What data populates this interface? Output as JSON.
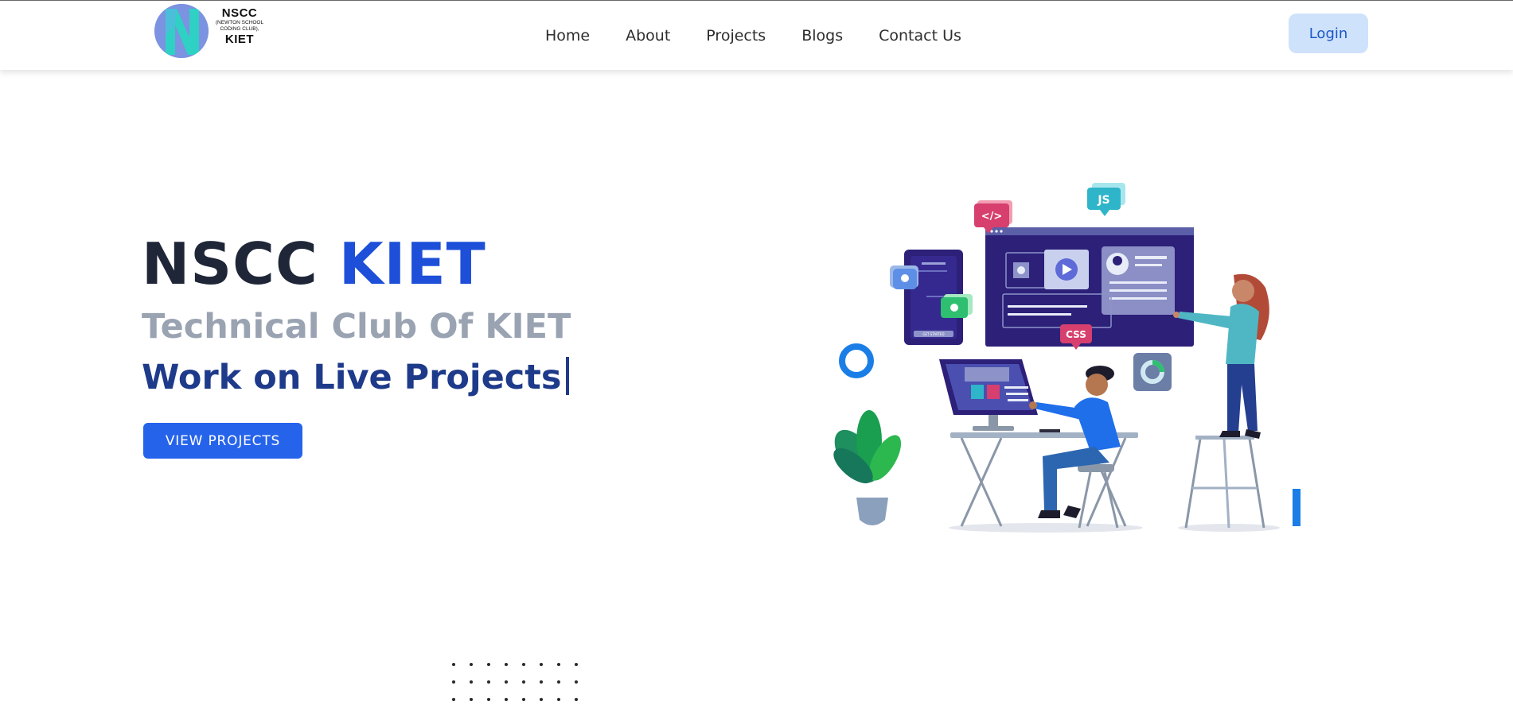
{
  "brand": {
    "logo_title": "NSCC",
    "logo_subtitle_line1": "(NEWTON SCHOOL",
    "logo_subtitle_line2": "CODING CLUB),",
    "logo_kiet": "KIET",
    "colors": {
      "logo_circle": "#7b93e0",
      "logo_n": "#2fd1c4"
    }
  },
  "nav": {
    "links": [
      "Home",
      "About",
      "Projects",
      "Blogs",
      "Contact Us"
    ],
    "login_label": "Login"
  },
  "hero": {
    "title_part1": "NSCC",
    "title_accent": "KIET",
    "subtitle": "Technical Club Of KIET",
    "typed_text": "Work on Live Projects",
    "cta_label": "VIEW PROJECTS"
  },
  "illustration": {
    "badges": {
      "code": "</>",
      "js": "JS",
      "css": "CSS"
    },
    "phone_button": "GET STARTED"
  },
  "colors": {
    "accent": "#1d4fd8",
    "button": "#2563eb",
    "login_bg": "#cfe2fb",
    "heading": "#1f2638",
    "subtitle": "#9aa3b2",
    "typed": "#1e3a8a"
  }
}
